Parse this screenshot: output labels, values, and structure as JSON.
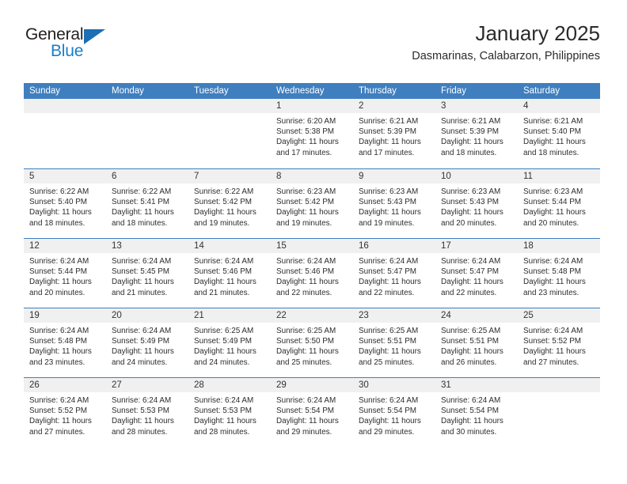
{
  "brand": {
    "word_one": "General",
    "word_two": "Blue",
    "triangle_color": "#1a6fb5",
    "blue_text_color": "#1a7ec8"
  },
  "header": {
    "month_title": "January 2025",
    "location": "Dasmarinas, Calabarzon, Philippines"
  },
  "theme": {
    "header_blue": "#3f7fbf",
    "day_band_gray": "#f0f0f0",
    "text_color": "#2d2d2d"
  },
  "calendar": {
    "weekday_headers": [
      "Sunday",
      "Monday",
      "Tuesday",
      "Wednesday",
      "Thursday",
      "Friday",
      "Saturday"
    ],
    "labels": {
      "sunrise": "Sunrise:",
      "sunset": "Sunset:",
      "daylight": "Daylight:"
    },
    "weeks": [
      [
        {
          "day": "",
          "sunrise": "",
          "sunset": "",
          "daylight_line1": "",
          "daylight_line2": ""
        },
        {
          "day": "",
          "sunrise": "",
          "sunset": "",
          "daylight_line1": "",
          "daylight_line2": ""
        },
        {
          "day": "",
          "sunrise": "",
          "sunset": "",
          "daylight_line1": "",
          "daylight_line2": ""
        },
        {
          "day": "1",
          "sunrise": "Sunrise: 6:20 AM",
          "sunset": "Sunset: 5:38 PM",
          "daylight_line1": "Daylight: 11 hours",
          "daylight_line2": "and 17 minutes."
        },
        {
          "day": "2",
          "sunrise": "Sunrise: 6:21 AM",
          "sunset": "Sunset: 5:39 PM",
          "daylight_line1": "Daylight: 11 hours",
          "daylight_line2": "and 17 minutes."
        },
        {
          "day": "3",
          "sunrise": "Sunrise: 6:21 AM",
          "sunset": "Sunset: 5:39 PM",
          "daylight_line1": "Daylight: 11 hours",
          "daylight_line2": "and 18 minutes."
        },
        {
          "day": "4",
          "sunrise": "Sunrise: 6:21 AM",
          "sunset": "Sunset: 5:40 PM",
          "daylight_line1": "Daylight: 11 hours",
          "daylight_line2": "and 18 minutes."
        }
      ],
      [
        {
          "day": "5",
          "sunrise": "Sunrise: 6:22 AM",
          "sunset": "Sunset: 5:40 PM",
          "daylight_line1": "Daylight: 11 hours",
          "daylight_line2": "and 18 minutes."
        },
        {
          "day": "6",
          "sunrise": "Sunrise: 6:22 AM",
          "sunset": "Sunset: 5:41 PM",
          "daylight_line1": "Daylight: 11 hours",
          "daylight_line2": "and 18 minutes."
        },
        {
          "day": "7",
          "sunrise": "Sunrise: 6:22 AM",
          "sunset": "Sunset: 5:42 PM",
          "daylight_line1": "Daylight: 11 hours",
          "daylight_line2": "and 19 minutes."
        },
        {
          "day": "8",
          "sunrise": "Sunrise: 6:23 AM",
          "sunset": "Sunset: 5:42 PM",
          "daylight_line1": "Daylight: 11 hours",
          "daylight_line2": "and 19 minutes."
        },
        {
          "day": "9",
          "sunrise": "Sunrise: 6:23 AM",
          "sunset": "Sunset: 5:43 PM",
          "daylight_line1": "Daylight: 11 hours",
          "daylight_line2": "and 19 minutes."
        },
        {
          "day": "10",
          "sunrise": "Sunrise: 6:23 AM",
          "sunset": "Sunset: 5:43 PM",
          "daylight_line1": "Daylight: 11 hours",
          "daylight_line2": "and 20 minutes."
        },
        {
          "day": "11",
          "sunrise": "Sunrise: 6:23 AM",
          "sunset": "Sunset: 5:44 PM",
          "daylight_line1": "Daylight: 11 hours",
          "daylight_line2": "and 20 minutes."
        }
      ],
      [
        {
          "day": "12",
          "sunrise": "Sunrise: 6:24 AM",
          "sunset": "Sunset: 5:44 PM",
          "daylight_line1": "Daylight: 11 hours",
          "daylight_line2": "and 20 minutes."
        },
        {
          "day": "13",
          "sunrise": "Sunrise: 6:24 AM",
          "sunset": "Sunset: 5:45 PM",
          "daylight_line1": "Daylight: 11 hours",
          "daylight_line2": "and 21 minutes."
        },
        {
          "day": "14",
          "sunrise": "Sunrise: 6:24 AM",
          "sunset": "Sunset: 5:46 PM",
          "daylight_line1": "Daylight: 11 hours",
          "daylight_line2": "and 21 minutes."
        },
        {
          "day": "15",
          "sunrise": "Sunrise: 6:24 AM",
          "sunset": "Sunset: 5:46 PM",
          "daylight_line1": "Daylight: 11 hours",
          "daylight_line2": "and 22 minutes."
        },
        {
          "day": "16",
          "sunrise": "Sunrise: 6:24 AM",
          "sunset": "Sunset: 5:47 PM",
          "daylight_line1": "Daylight: 11 hours",
          "daylight_line2": "and 22 minutes."
        },
        {
          "day": "17",
          "sunrise": "Sunrise: 6:24 AM",
          "sunset": "Sunset: 5:47 PM",
          "daylight_line1": "Daylight: 11 hours",
          "daylight_line2": "and 22 minutes."
        },
        {
          "day": "18",
          "sunrise": "Sunrise: 6:24 AM",
          "sunset": "Sunset: 5:48 PM",
          "daylight_line1": "Daylight: 11 hours",
          "daylight_line2": "and 23 minutes."
        }
      ],
      [
        {
          "day": "19",
          "sunrise": "Sunrise: 6:24 AM",
          "sunset": "Sunset: 5:48 PM",
          "daylight_line1": "Daylight: 11 hours",
          "daylight_line2": "and 23 minutes."
        },
        {
          "day": "20",
          "sunrise": "Sunrise: 6:24 AM",
          "sunset": "Sunset: 5:49 PM",
          "daylight_line1": "Daylight: 11 hours",
          "daylight_line2": "and 24 minutes."
        },
        {
          "day": "21",
          "sunrise": "Sunrise: 6:25 AM",
          "sunset": "Sunset: 5:49 PM",
          "daylight_line1": "Daylight: 11 hours",
          "daylight_line2": "and 24 minutes."
        },
        {
          "day": "22",
          "sunrise": "Sunrise: 6:25 AM",
          "sunset": "Sunset: 5:50 PM",
          "daylight_line1": "Daylight: 11 hours",
          "daylight_line2": "and 25 minutes."
        },
        {
          "day": "23",
          "sunrise": "Sunrise: 6:25 AM",
          "sunset": "Sunset: 5:51 PM",
          "daylight_line1": "Daylight: 11 hours",
          "daylight_line2": "and 25 minutes."
        },
        {
          "day": "24",
          "sunrise": "Sunrise: 6:25 AM",
          "sunset": "Sunset: 5:51 PM",
          "daylight_line1": "Daylight: 11 hours",
          "daylight_line2": "and 26 minutes."
        },
        {
          "day": "25",
          "sunrise": "Sunrise: 6:24 AM",
          "sunset": "Sunset: 5:52 PM",
          "daylight_line1": "Daylight: 11 hours",
          "daylight_line2": "and 27 minutes."
        }
      ],
      [
        {
          "day": "26",
          "sunrise": "Sunrise: 6:24 AM",
          "sunset": "Sunset: 5:52 PM",
          "daylight_line1": "Daylight: 11 hours",
          "daylight_line2": "and 27 minutes."
        },
        {
          "day": "27",
          "sunrise": "Sunrise: 6:24 AM",
          "sunset": "Sunset: 5:53 PM",
          "daylight_line1": "Daylight: 11 hours",
          "daylight_line2": "and 28 minutes."
        },
        {
          "day": "28",
          "sunrise": "Sunrise: 6:24 AM",
          "sunset": "Sunset: 5:53 PM",
          "daylight_line1": "Daylight: 11 hours",
          "daylight_line2": "and 28 minutes."
        },
        {
          "day": "29",
          "sunrise": "Sunrise: 6:24 AM",
          "sunset": "Sunset: 5:54 PM",
          "daylight_line1": "Daylight: 11 hours",
          "daylight_line2": "and 29 minutes."
        },
        {
          "day": "30",
          "sunrise": "Sunrise: 6:24 AM",
          "sunset": "Sunset: 5:54 PM",
          "daylight_line1": "Daylight: 11 hours",
          "daylight_line2": "and 29 minutes."
        },
        {
          "day": "31",
          "sunrise": "Sunrise: 6:24 AM",
          "sunset": "Sunset: 5:54 PM",
          "daylight_line1": "Daylight: 11 hours",
          "daylight_line2": "and 30 minutes."
        },
        {
          "day": "",
          "sunrise": "",
          "sunset": "",
          "daylight_line1": "",
          "daylight_line2": ""
        }
      ]
    ]
  }
}
